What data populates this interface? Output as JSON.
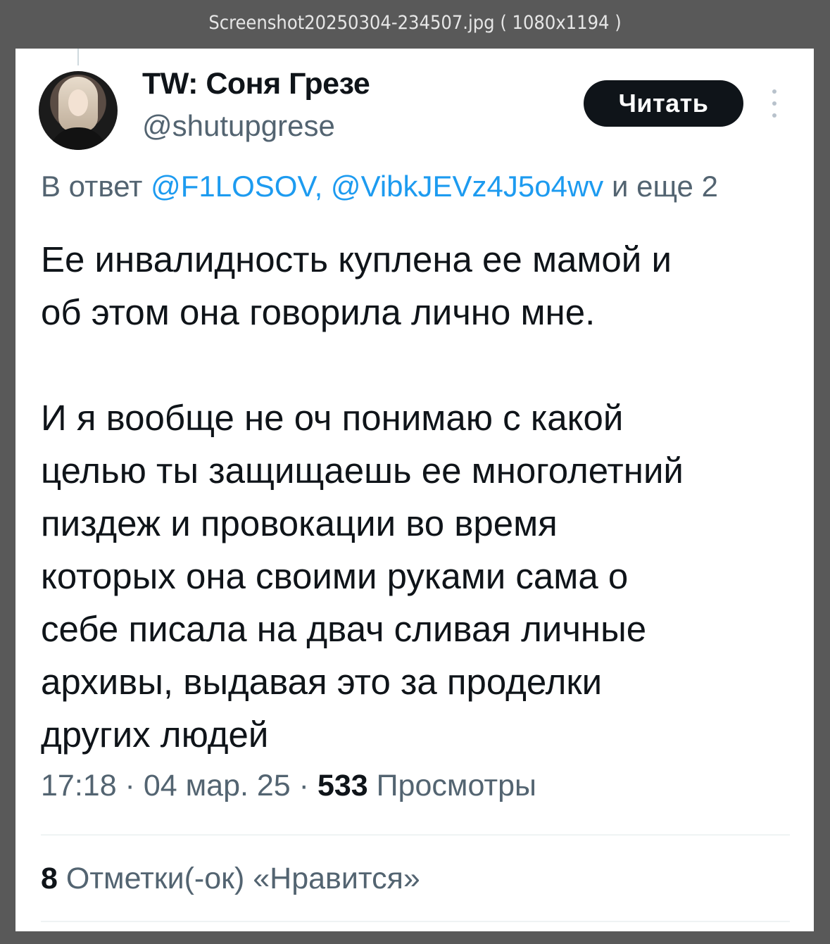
{
  "viewer": {
    "title": "Screenshot20250304-234507.jpg ( 1080x1194 )"
  },
  "tweet": {
    "author": {
      "display_name": "TW: Соня Грезе",
      "handle": "@shutupgrese"
    },
    "follow_label": "Читать",
    "reply_prefix": "В ответ ",
    "reply_mentions": "@F1LOSOV, @VibkJEVz4J5o4wv",
    "reply_suffix": " и еще 2",
    "text": "Ее инвалидность куплена ее мамой и\nоб этом она говорила лично мне.\n\nИ я вообще не оч понимаю с какой\nцелью ты защищаешь ее многолетний\nпиздеж и провокации во время\nкоторых она своими руками сама о\nсебе писала на двач сливая личные\nархивы, выдавая это за проделки\nдругих людей",
    "time": "17:18",
    "date": "04 мар. 25",
    "views_count": "533",
    "views_label": "Просмотры",
    "likes_count": "8",
    "likes_label": "Отметки(-ок) «Нравится»"
  },
  "colors": {
    "viewer_background": "#595959",
    "text_primary": "#0f1419",
    "text_secondary": "#536471",
    "link": "#1d9bf0",
    "follow_button": "#0f1419"
  },
  "icons": {
    "more": "more-vertical-icon"
  }
}
